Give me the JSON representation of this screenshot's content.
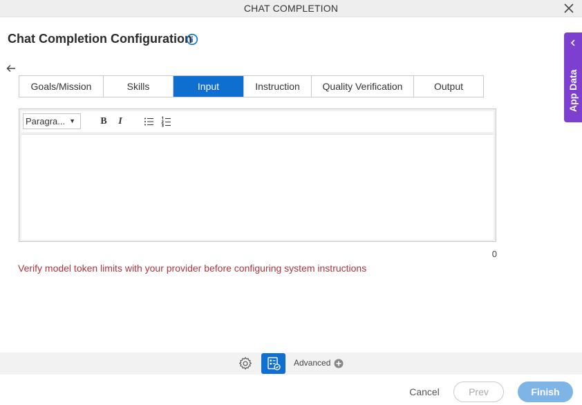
{
  "window": {
    "title": "CHAT COMPLETION"
  },
  "page": {
    "heading": "Chat Completion Configuration"
  },
  "tabs": [
    {
      "label": "Goals/Mission",
      "active": false
    },
    {
      "label": "Skills",
      "active": false
    },
    {
      "label": "Input",
      "active": true
    },
    {
      "label": "Instruction",
      "active": false
    },
    {
      "label": "Quality Verification",
      "active": false
    },
    {
      "label": "Output",
      "active": false
    }
  ],
  "editor": {
    "format_select": "Paragra...",
    "bold_label": "B",
    "italic_label": "I",
    "content": "",
    "char_count": "0"
  },
  "warning": "Verify model token limits with your provider before configuring system instructions",
  "side_panel": {
    "label": "App Data"
  },
  "bottom_bar": {
    "advanced_label": "Advanced"
  },
  "footer": {
    "cancel": "Cancel",
    "prev": "Prev",
    "finish": "Finish"
  },
  "colors": {
    "accent": "#0e6fd0",
    "side_panel": "#7c3fd0",
    "warning": "#b0343b",
    "finish_disabled": "#7fb4e6"
  },
  "icons": [
    "close-icon",
    "info-icon",
    "back-arrow-icon",
    "caret-down-icon",
    "bullet-list-icon",
    "numbered-list-icon",
    "chevron-left-icon",
    "gear-icon",
    "form-check-icon",
    "plus-circle-icon"
  ]
}
